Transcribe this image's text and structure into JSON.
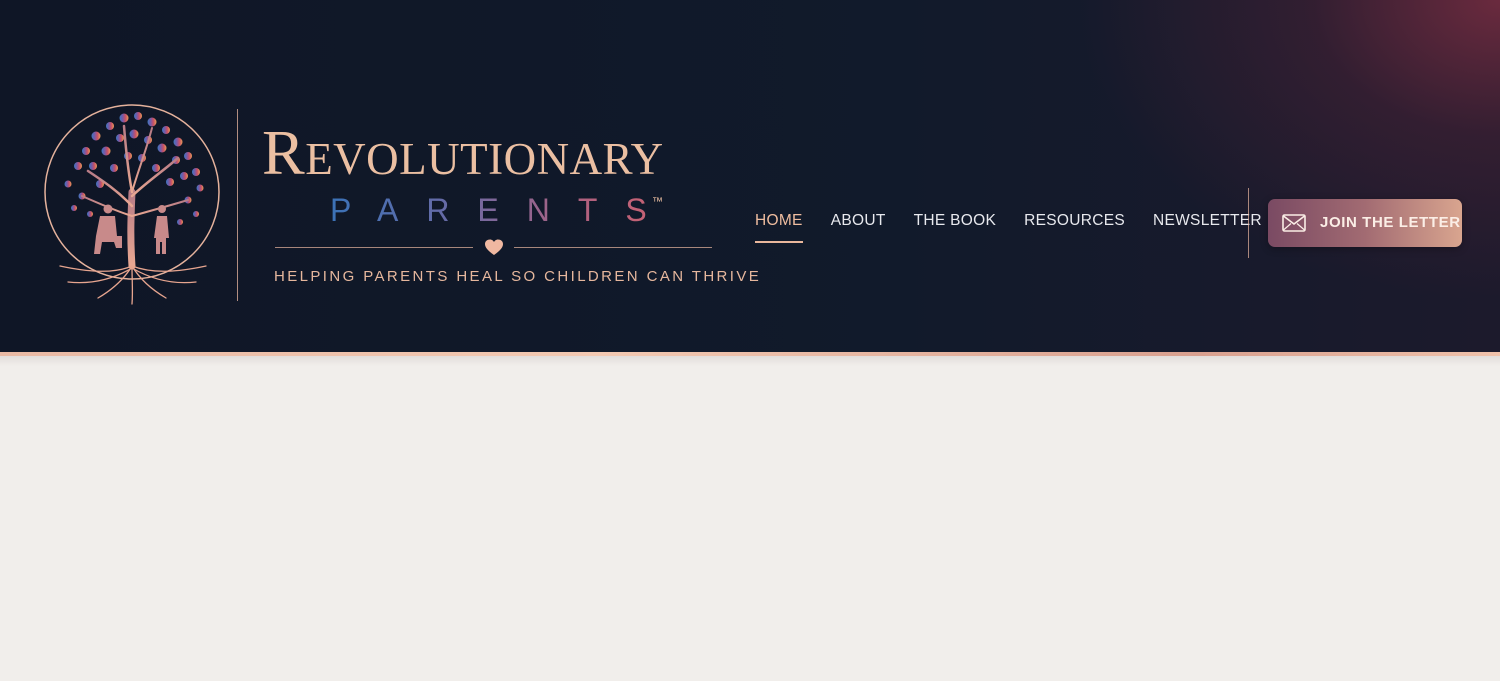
{
  "brand": {
    "name": "Revolutionary",
    "sub": "PARENTS",
    "trademark": "™",
    "tagline": "HELPING PARENTS HEAL SO CHILDREN CAN THRIVE"
  },
  "icons": {
    "logo": "tree-of-life-icon",
    "ornament": "heart-icon",
    "cta": "envelope-icon"
  },
  "nav": {
    "items": [
      {
        "label": "HOME",
        "active": true
      },
      {
        "label": "ABOUT",
        "active": false
      },
      {
        "label": "THE BOOK",
        "active": false
      },
      {
        "label": "RESOURCES",
        "active": false
      },
      {
        "label": "NEWSLETTER",
        "active": false
      }
    ]
  },
  "cta": {
    "label": "JOIN THE LETTER"
  },
  "colors": {
    "header_bg": "#0f1626",
    "accent": "#ebbfa2",
    "page_bg": "#f1eeeb",
    "cta_start": "#7a4a63",
    "cta_end": "#d9a58f"
  }
}
